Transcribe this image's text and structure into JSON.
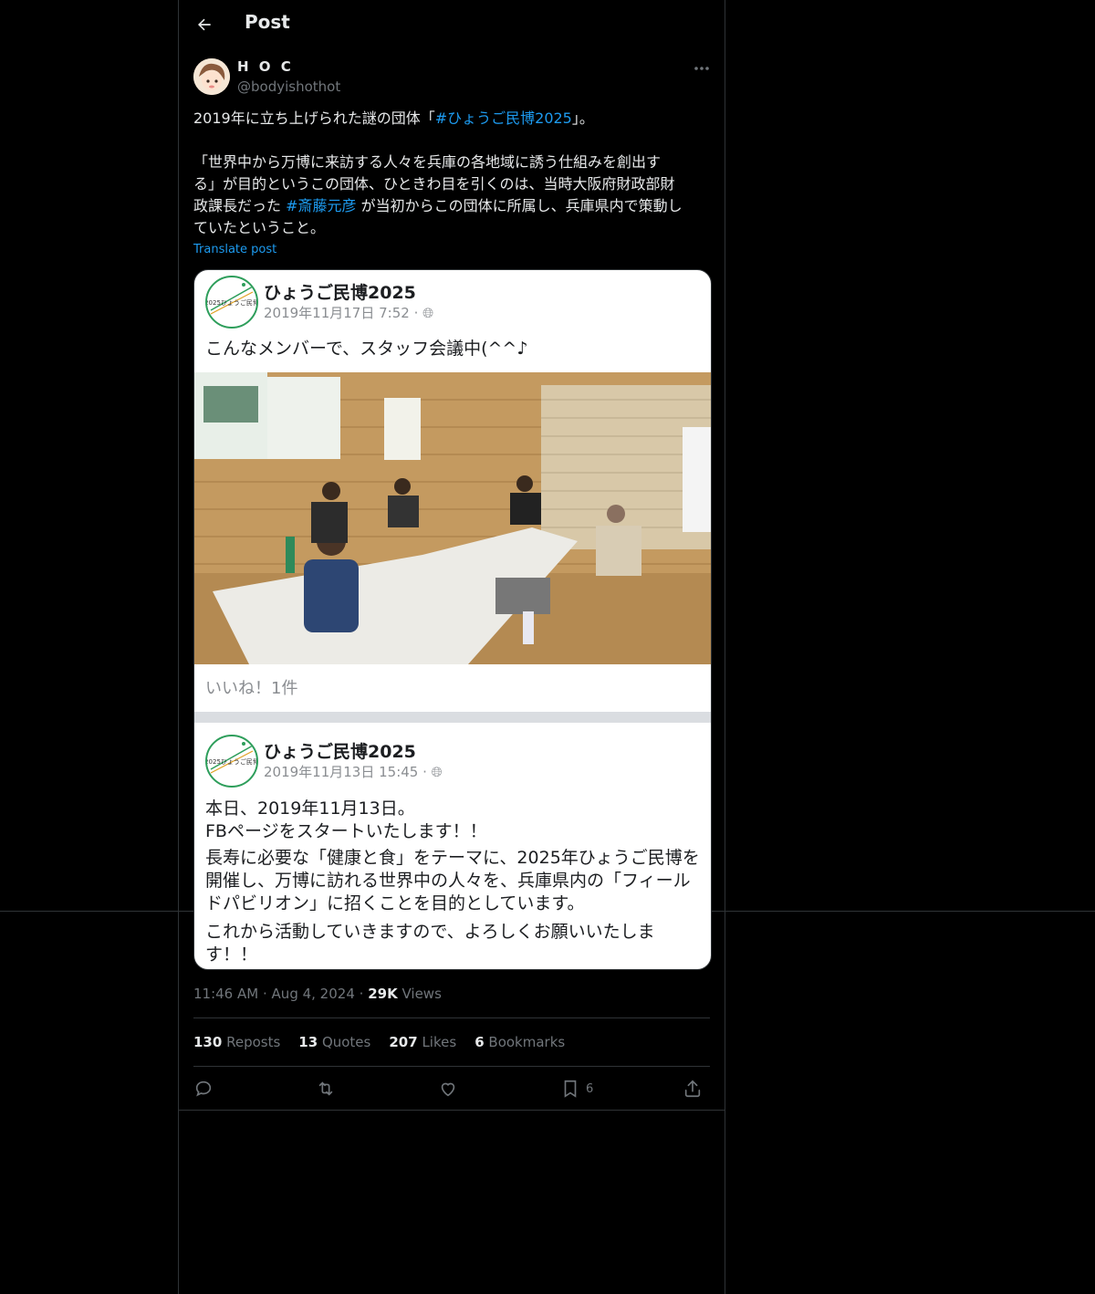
{
  "header": {
    "title": "Post",
    "back_icon": "arrow-left-icon"
  },
  "author": {
    "name": "H O C",
    "handle": "@bodyishothot"
  },
  "post": {
    "line1_pre": "2019年に立ち上げられた謎の団体「",
    "hashtag1": "#ひょうご民博2025",
    "line1_post": "」。",
    "para2_line1": "「世界中から万博に来訪する人々を兵庫の各地域に誘う仕組みを創出す",
    "para2_line2": "る」が目的というこの団体、ひときわ目を引くのは、当時大阪府財政部財",
    "para2_line3_pre": "政課長だった",
    "hashtag2": "#斎藤元彦",
    "para2_line3_post": "が当初からこの団体に所属し、兵庫県内で策動し",
    "para2_line4": "ていたということ。",
    "translate_label": "Translate post"
  },
  "media": {
    "post1": {
      "page_name": "ひょうご民博2025",
      "date": "2019年11月17日 7:52 ·",
      "text": "こんなメンバーで、スタッフ会議中(^^♪",
      "likes": "いいね！1件"
    },
    "post2": {
      "page_name": "ひょうご民博2025",
      "date": "2019年11月13日 15:45 ·",
      "line1": "本日、2019年11月13日。",
      "line2": "FBページをスタートいたします！！",
      "line3": "長寿に必要な「健康と食」をテーマに、2025年ひょうご民博を",
      "line4": "開催し、万博に訪れる世界中の人々を、兵庫県内の「フィール",
      "line5": "ドパビリオン」に招くことを目的としています。",
      "line6": "これから活動していきますので、よろしくお願いいたしま",
      "line7": "す！！"
    },
    "logo_text": "2025ひょうご民博"
  },
  "meta": {
    "time": "11:46 AM",
    "sep": "·",
    "date": "Aug 4, 2024",
    "views_count": "29K",
    "views_label": "Views"
  },
  "stats": [
    {
      "count": "130",
      "label": "Reposts"
    },
    {
      "count": "13",
      "label": "Quotes"
    },
    {
      "count": "207",
      "label": "Likes"
    },
    {
      "count": "6",
      "label": "Bookmarks"
    }
  ],
  "actions": {
    "bookmark_count": "6"
  },
  "colors": {
    "accent": "#1d9bf0",
    "background": "#000000",
    "muted": "#71767b"
  }
}
